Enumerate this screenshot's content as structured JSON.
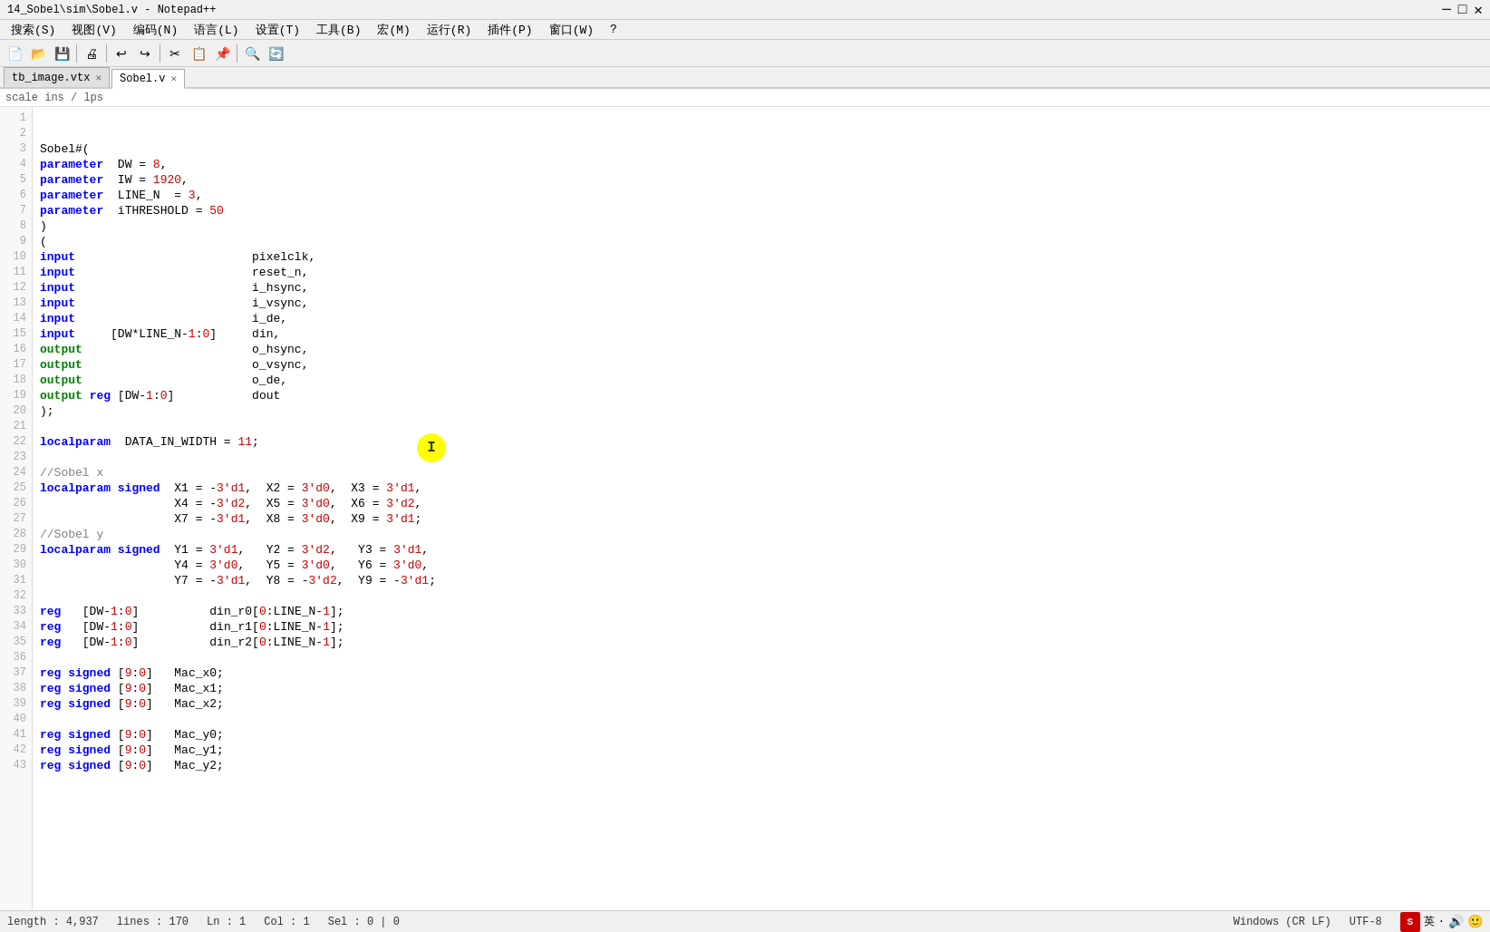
{
  "title": {
    "text": "14_Sobel\\sim\\Sobel.v - Notepad++"
  },
  "menu": {
    "items": [
      {
        "label": "搜索(S)"
      },
      {
        "label": "视图(V)"
      },
      {
        "label": "编码(N)"
      },
      {
        "label": "语言(L)"
      },
      {
        "label": "设置(T)"
      },
      {
        "label": "工具(B)"
      },
      {
        "label": "宏(M)"
      },
      {
        "label": "运行(R)"
      },
      {
        "label": "插件(P)"
      },
      {
        "label": "窗口(W)"
      },
      {
        "label": "?"
      }
    ]
  },
  "tabs": [
    {
      "label": "tb_image.vtx",
      "active": false,
      "closeable": true
    },
    {
      "label": "Sobel.v",
      "active": true,
      "closeable": true
    }
  ],
  "breadcrumb": "scale  ins  /  lps",
  "code": {
    "lines": [
      "",
      "Sobel#(",
      "parameter  DW = 8,",
      "parameter  IW = 1920,",
      "parameter  LINE_N  = 3,",
      "parameter  iTHRESHOLD = 50",
      ")",
      "(",
      "input                         pixelclk,",
      "input                         reset_n,",
      "input                         i_hsync,",
      "input                         i_vsync,",
      "input                         i_de,",
      "input     [DW*LINE_N-1:0]     din,",
      "output                        o_hsync,",
      "output                        o_vsync,",
      "output                        o_de,",
      "output reg [DW-1:0]           dout",
      ");",
      "",
      "localparam  DATA_IN_WIDTH = 11;",
      "",
      "//Sobel x",
      "localparam signed  X1 = -3'd1,  X2 = 3'd0,  X3 = 3'd1,",
      "                   X4 = -3'd2,  X5 = 3'd0,  X6 = 3'd2,",
      "                   X7 = -3'd1,  X8 = 3'd0,  X9 = 3'd1;",
      "//Sobel y",
      "localparam signed  Y1 = 3'd1,   Y2 = 3'd2,   Y3 = 3'd1,",
      "                   Y4 = 3'd0,   Y5 = 3'd0,   Y6 = 3'd0,",
      "                   Y7 = -3'd1,  Y8 = -3'd2,  Y9 = -3'd1;",
      "",
      "reg   [DW-1:0]          din_r0[0:LINE_N-1];",
      "reg   [DW-1:0]          din_r1[0:LINE_N-1];",
      "reg   [DW-1:0]          din_r2[0:LINE_N-1];",
      "",
      "reg signed [9:0]   Mac_x0;",
      "reg signed [9:0]   Mac_x1;",
      "reg signed [9:0]   Mac_x2;",
      "",
      "reg signed [9:0]   Mac_y0;",
      "reg signed [9:0]   Mac_y1;",
      "reg signed [9:0]   Mac_y2;"
    ]
  },
  "status": {
    "length": "length : 4,937",
    "lines": "lines : 170",
    "ln": "Ln : 1",
    "col": "Col : 1",
    "sel": "Sel : 0 | 0",
    "encoding": "Windows (CR LF)",
    "charset": "UTF-8"
  }
}
